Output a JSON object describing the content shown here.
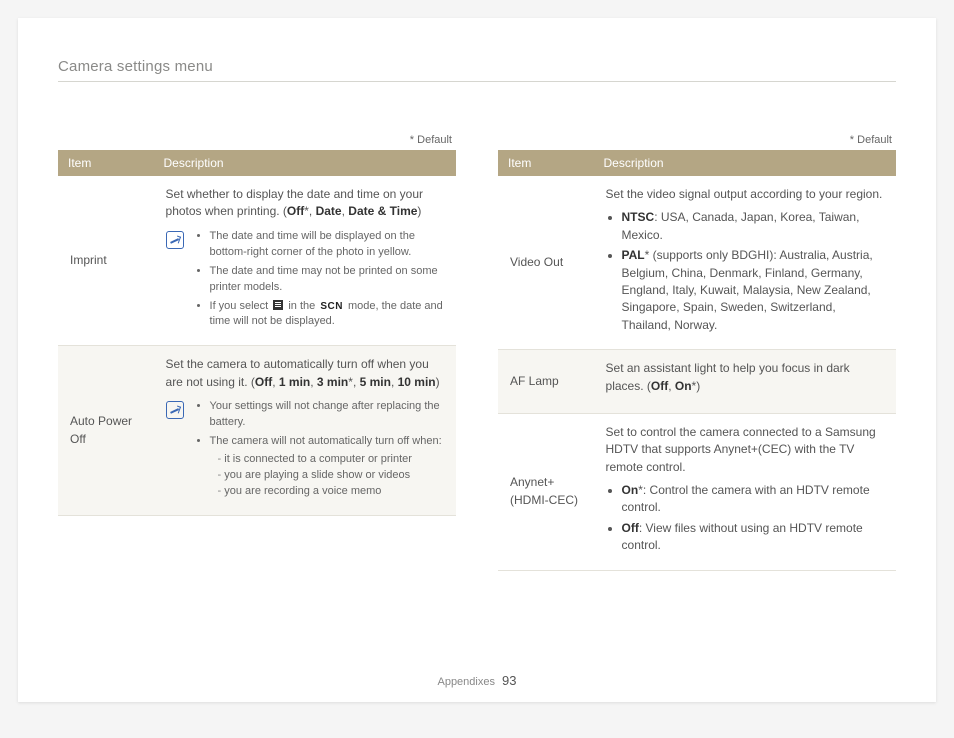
{
  "section_title": "Camera settings menu",
  "default_label": "* Default",
  "headers": {
    "item": "Item",
    "desc": "Description"
  },
  "footer": {
    "label": "Appendixes",
    "page": "93"
  },
  "left": {
    "rows": [
      {
        "item": "Imprint",
        "lead_pre": "Set whether to display the date and time on your photos when printing. (",
        "opt1": "Off",
        "opt1_suffix": "*",
        "sep1": ", ",
        "opt2": "Date",
        "sep2": ", ",
        "opt3": "Date & Time",
        "lead_post": ")",
        "note_type": "icon",
        "notes": [
          "The date and time will be displayed on the bottom-right corner of the photo in yellow.",
          "The date and time may not be printed on some printer models.",
          {
            "pre": "If you select ",
            "mid": " in the ",
            "post": " mode, the date and time will not be displayed."
          }
        ]
      },
      {
        "item": "Auto Power Off",
        "lead_pre": "Set the camera to automatically turn off when you are not using it. (",
        "opt1": "Off",
        "sep1": ", ",
        "opt2": "1 min",
        "sep2": ", ",
        "opt3": "3 min",
        "opt3_suffix": "*",
        "sep3": ", ",
        "opt4": "5 min",
        "sep4": ", ",
        "opt5": "10 min",
        "lead_post": ")",
        "note_type": "icon",
        "notes": [
          "Your settings will not change after replacing the battery.",
          {
            "text": "The camera will not automatically turn off when:",
            "sub": [
              "it is connected to a computer or printer",
              "you are playing a slide show or videos",
              "you are recording a voice memo"
            ]
          }
        ]
      }
    ]
  },
  "right": {
    "rows": [
      {
        "item": "Video Out",
        "lead": "Set the video signal output according to your region.",
        "bullets": [
          {
            "label": "NTSC",
            "text": ": USA, Canada, Japan, Korea, Taiwan, Mexico."
          },
          {
            "label": "PAL",
            "label_suffix": "*",
            "paren": " (supports only BDGHI)",
            "text": ": Australia, Austria, Belgium, China, Denmark, Finland, Germany, England, Italy, Kuwait, Malaysia, New Zealand, Singapore, Spain, Sweden, Switzerland, Thailand, Norway."
          }
        ]
      },
      {
        "item": "AF Lamp",
        "lead_pre": "Set an assistant light to help you focus in dark places. (",
        "opt1": "Off",
        "sep1": ", ",
        "opt2": "On",
        "opt2_suffix": "*",
        "lead_post": ")"
      },
      {
        "item": "Anynet+ (HDMI-CEC)",
        "lead": "Set to control the camera connected to a Samsung HDTV that supports Anynet+(CEC) with the TV remote control.",
        "bullets": [
          {
            "label": "On",
            "label_suffix": "*",
            "text": ": Control the camera with an HDTV remote control."
          },
          {
            "label": "Off",
            "text": ": View files without using an HDTV remote control."
          }
        ]
      }
    ]
  }
}
